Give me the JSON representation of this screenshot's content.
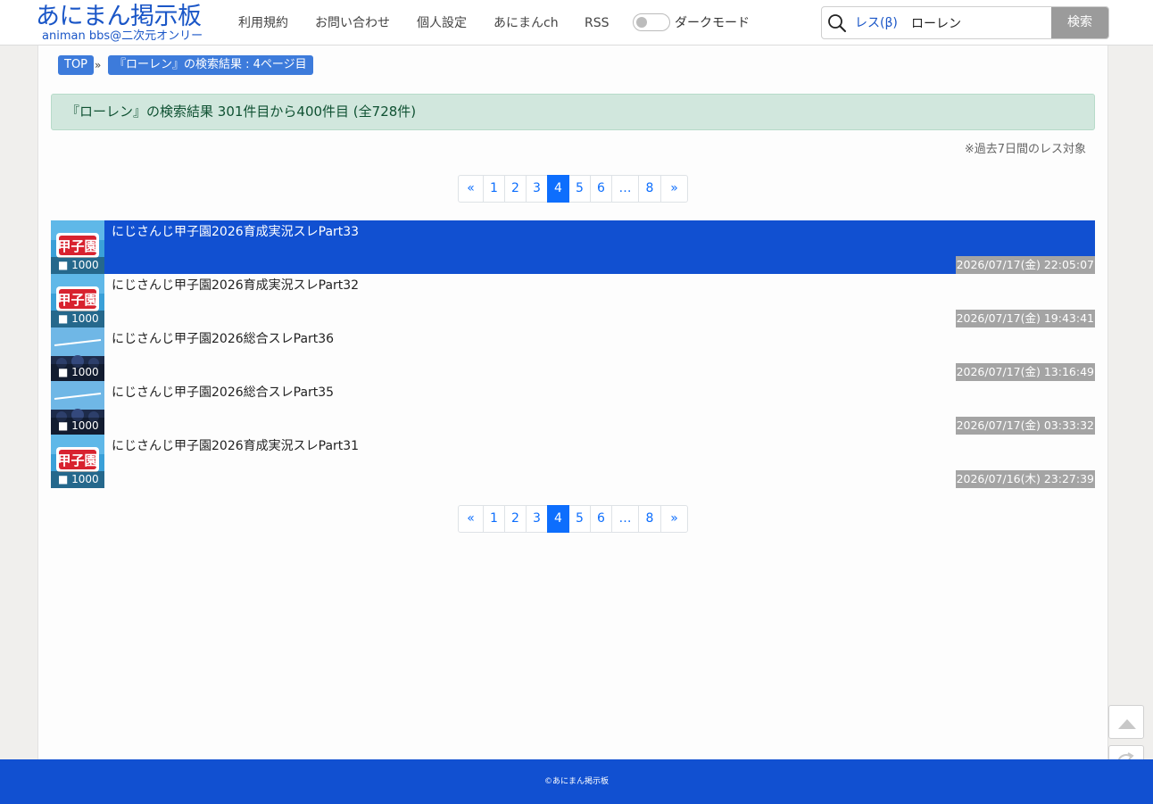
{
  "header": {
    "logo_main": "あにまん掲示板",
    "logo_sub": "animan bbs@二次元オンリー",
    "nav": [
      "利用規約",
      "お問い合わせ",
      "個人設定",
      "あにまんch",
      "RSS"
    ],
    "dark_mode_label": "ダークモード",
    "dark_mode_on": false,
    "search_scope": "レス(β)",
    "search_value": "ローレン",
    "search_button": "検索"
  },
  "breadcrumb": {
    "top": "TOP",
    "separator": "»",
    "current": "『ローレン』の検索結果 : 4ページ目"
  },
  "result_summary": "『ローレン』の検索結果 301件目から400件目 (全728件)",
  "note": "※過去7日間のレス対象",
  "pagination": {
    "prev": "«",
    "pages": [
      "1",
      "2",
      "3",
      "4",
      "5",
      "6",
      "…",
      "8"
    ],
    "current": "4",
    "next": "»"
  },
  "threads": [
    {
      "title": "にじさんじ甲子園2026育成実況スレPart33",
      "count": "1000",
      "date": "2026/07/17(金) 22:05:07",
      "thumb": "koshien-logo",
      "highlight": true
    },
    {
      "title": "にじさんじ甲子園2026育成実況スレPart32",
      "count": "1000",
      "date": "2026/07/17(金) 19:43:41",
      "thumb": "koshien-logo",
      "highlight": false
    },
    {
      "title": "にじさんじ甲子園2026総合スレPart36",
      "count": "1000",
      "date": "2026/07/17(金) 13:16:49",
      "thumb": "team-photo",
      "highlight": false
    },
    {
      "title": "にじさんじ甲子園2026総合スレPart35",
      "count": "1000",
      "date": "2026/07/17(金) 03:33:32",
      "thumb": "team-photo",
      "highlight": false
    },
    {
      "title": "にじさんじ甲子園2026育成実況スレPart31",
      "count": "1000",
      "date": "2026/07/16(木) 23:27:39",
      "thumb": "koshien-logo",
      "highlight": false
    }
  ],
  "footer": "©あにまん掲示板",
  "colors": {
    "brand": "#1150d1",
    "link": "#0d6efd",
    "alert_bg": "#d1e7dd"
  }
}
